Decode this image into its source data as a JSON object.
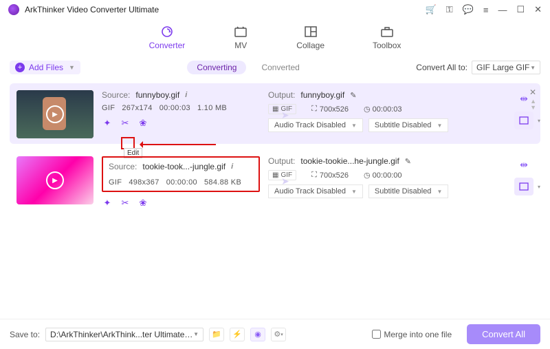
{
  "app": {
    "title": "ArkThinker Video Converter Ultimate"
  },
  "tabs": {
    "converter": "Converter",
    "mv": "MV",
    "collage": "Collage",
    "toolbox": "Toolbox"
  },
  "toolbar": {
    "add_files": "Add Files",
    "converting": "Converting",
    "converted": "Converted",
    "convert_all_to": "Convert All to:",
    "convert_all_format": "GIF Large GIF"
  },
  "items": [
    {
      "source_label": "Source:",
      "source_name": "funnyboy.gif",
      "format": "GIF",
      "resolution": "267x174",
      "duration": "00:00:03",
      "size": "1.10 MB",
      "edit_tooltip": "Edit",
      "output_label": "Output:",
      "output_name": "funnyboy.gif",
      "out_format": "GIF",
      "out_resolution": "700x526",
      "out_duration": "00:00:03",
      "audio_track": "Audio Track Disabled",
      "subtitle": "Subtitle Disabled"
    },
    {
      "source_label": "Source:",
      "source_name": "tookie-took...-jungle.gif",
      "format": "GIF",
      "resolution": "498x367",
      "duration": "00:00:00",
      "size": "584.88 KB",
      "output_label": "Output:",
      "output_name": "tookie-tookie...he-jungle.gif",
      "out_format": "GIF",
      "out_resolution": "700x526",
      "out_duration": "00:00:00",
      "audio_track": "Audio Track Disabled",
      "subtitle": "Subtitle Disabled"
    }
  ],
  "bottom": {
    "save_to": "Save to:",
    "path": "D:\\ArkThinker\\ArkThink...ter Ultimate\\Converted",
    "merge": "Merge into one file",
    "convert_all": "Convert All"
  }
}
